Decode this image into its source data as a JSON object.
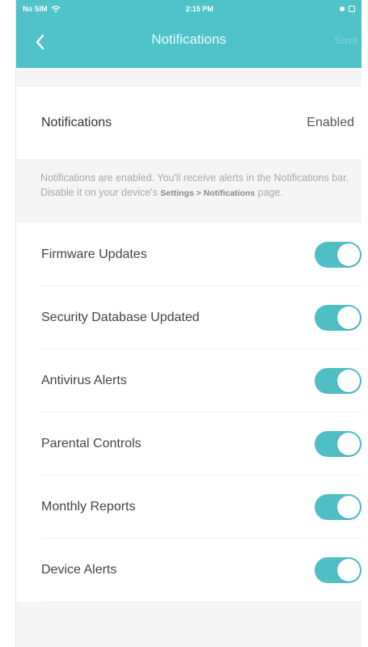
{
  "status_bar": {
    "carrier": "No SIM",
    "time": "2:15 PM"
  },
  "header": {
    "title": "Notifications",
    "save_label": "Save"
  },
  "summary": {
    "label": "Notifications",
    "value": "Enabled"
  },
  "hint": {
    "text_before": "Notifications are enabled. You'll receive alerts in the Notifications bar. Disable it on your device's ",
    "path": "Settings > Notifications",
    "text_after": " page."
  },
  "toggles": [
    {
      "label": "Firmware Updates",
      "enabled": true
    },
    {
      "label": "Security Database Updated",
      "enabled": true
    },
    {
      "label": "Antivirus Alerts",
      "enabled": true
    },
    {
      "label": "Parental Controls",
      "enabled": true
    },
    {
      "label": "Monthly Reports",
      "enabled": true
    },
    {
      "label": "Device Alerts",
      "enabled": true
    }
  ],
  "colors": {
    "accent": "#4fc3c8",
    "switch_on": "#4fbfc5",
    "background": "#f5f5f5"
  }
}
